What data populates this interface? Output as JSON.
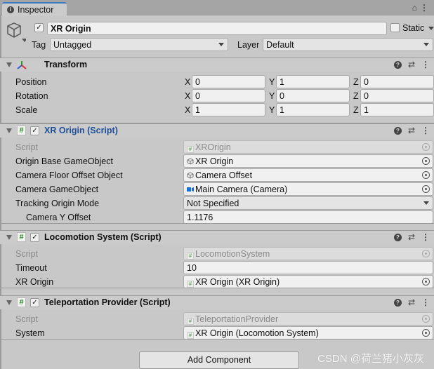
{
  "tab": {
    "label": "Inspector"
  },
  "gameobject": {
    "active": true,
    "name": "XR Origin",
    "static_label": "Static",
    "static": false,
    "tag_label": "Tag",
    "tag": "Untagged",
    "layer_label": "Layer",
    "layer": "Default"
  },
  "transform": {
    "title": "Transform",
    "rows": [
      {
        "label": "Position",
        "x": "0",
        "y": "1",
        "z": "0"
      },
      {
        "label": "Rotation",
        "x": "0",
        "y": "0",
        "z": "0"
      },
      {
        "label": "Scale",
        "x": "1",
        "y": "1",
        "z": "1"
      }
    ],
    "axis": {
      "x": "X",
      "y": "Y",
      "z": "Z"
    }
  },
  "xr_origin": {
    "title": "XR Origin (Script)",
    "enabled": true,
    "rows": [
      {
        "label": "Script",
        "value": "XROrigin"
      },
      {
        "label": "Origin Base GameObject",
        "value": "XR Origin"
      },
      {
        "label": "Camera Floor Offset Object",
        "value": "Camera Offset"
      },
      {
        "label": "Camera GameObject",
        "value": "Main Camera (Camera)"
      },
      {
        "label": "Tracking Origin Mode",
        "value": "Not Specified"
      },
      {
        "label": "Camera Y Offset",
        "value": "1.1176"
      }
    ]
  },
  "locomotion": {
    "title": "Locomotion System (Script)",
    "enabled": true,
    "rows": [
      {
        "label": "Script",
        "value": "LocomotionSystem"
      },
      {
        "label": "Timeout",
        "value": "10"
      },
      {
        "label": "XR Origin",
        "value": "XR Origin (XR Origin)"
      }
    ]
  },
  "teleport": {
    "title": "Teleportation Provider (Script)",
    "enabled": true,
    "rows": [
      {
        "label": "Script",
        "value": "TeleportationProvider"
      },
      {
        "label": "System",
        "value": "XR Origin (Locomotion System)"
      }
    ]
  },
  "add_component": "Add Component",
  "watermark": "CSDN @荷兰猪小灰灰",
  "colors": {
    "accent": "#3a79bb",
    "script_title": "#1f4f99",
    "bg": "#c8c8c8"
  }
}
